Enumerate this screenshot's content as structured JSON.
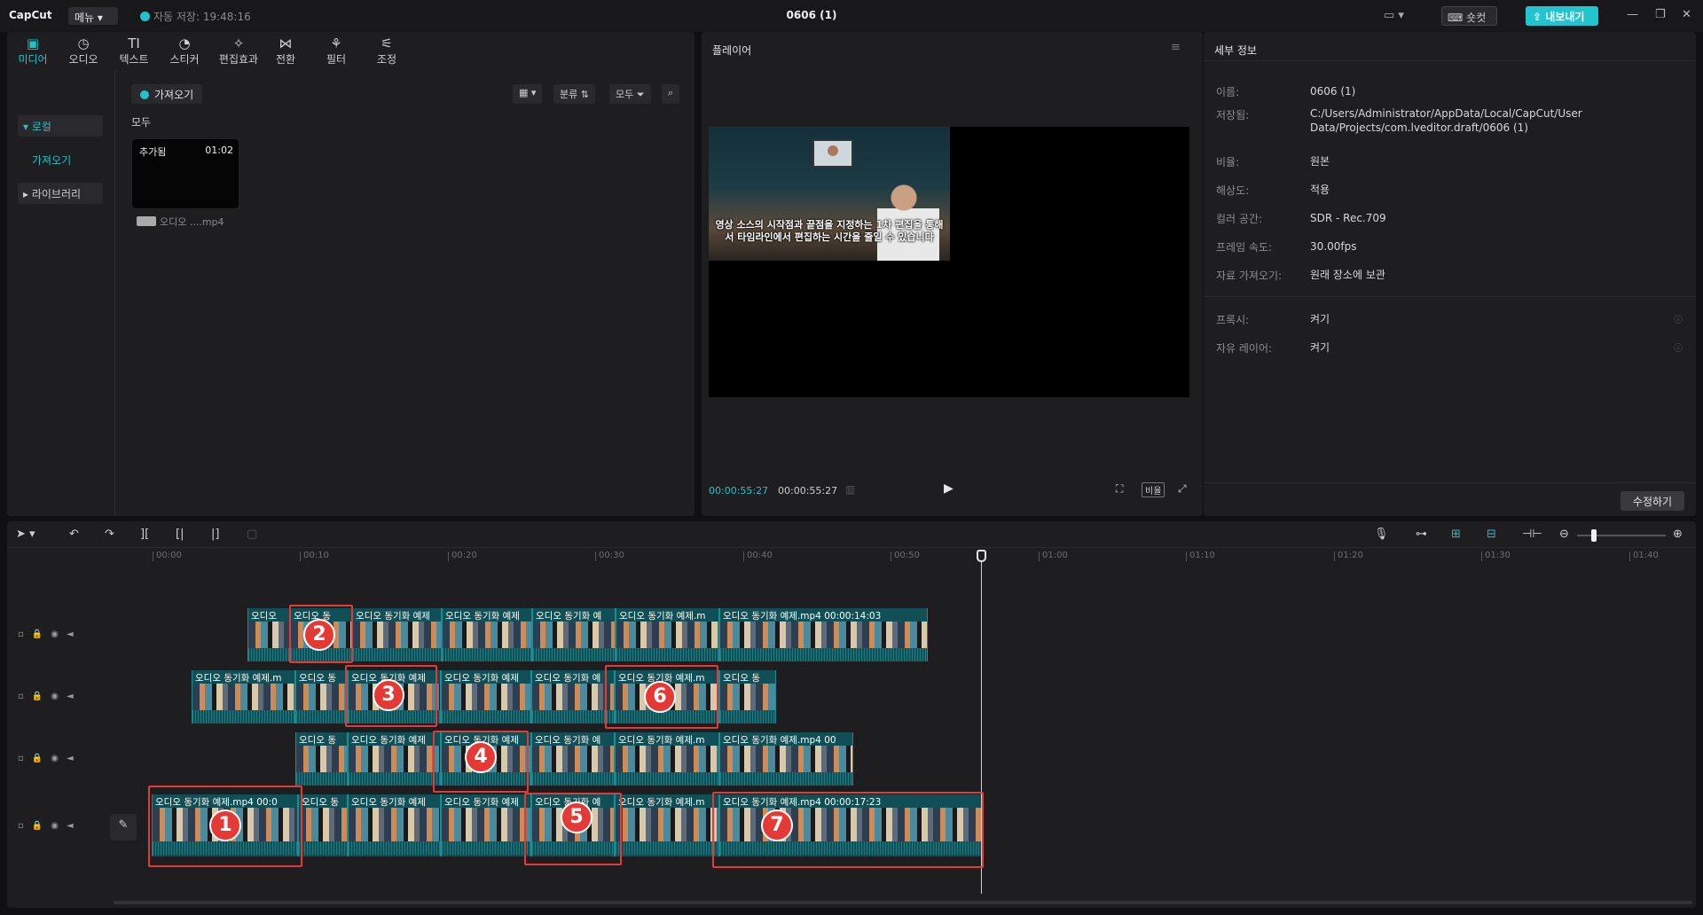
{
  "titlebar": {
    "logo": "CapCut",
    "menu_label": "메뉴",
    "autosave": "자동 저장: 19:48:16",
    "project_title": "0606 (1)",
    "shortcut_label": "숏컷",
    "export_label": "내보내기"
  },
  "media_tabs": [
    {
      "label": "미디어",
      "icon": "media-icon"
    },
    {
      "label": "오디오",
      "icon": "audio-icon"
    },
    {
      "label": "텍스트",
      "icon": "text-icon"
    },
    {
      "label": "스티커",
      "icon": "sticker-icon"
    },
    {
      "label": "편집효과",
      "icon": "effects-icon"
    },
    {
      "label": "전환",
      "icon": "transition-icon"
    },
    {
      "label": "필터",
      "icon": "filter-icon"
    },
    {
      "label": "조정",
      "icon": "adjust-icon"
    }
  ],
  "sidebar": {
    "local": "로컬",
    "import": "가져오기",
    "library": "라이브러리"
  },
  "media": {
    "import_button": "가져오기",
    "sort_label": "분류",
    "filter_label": "모두",
    "section_label": "모두",
    "clip": {
      "badge": "추가됨",
      "duration": "01:02",
      "name": "오디오 ....mp4"
    }
  },
  "player": {
    "title": "플레이어",
    "subtitle": "영상 소스의 시작점과 끝점을 지정하는 1차 편집을 통해서 타임라인에서 편집하는 시간을 줄일 수 있습니다",
    "current_time": "00:00:55:27",
    "total_time": "00:00:55:27",
    "ratio_label": "비율"
  },
  "details": {
    "title": "세부 정보",
    "rows": [
      {
        "label": "이름:",
        "value": "0606 (1)"
      },
      {
        "label": "저장됨:",
        "value": "C:/Users/Administrator/AppData/Local/CapCut/User Data/Projects/com.lveditor.draft/0606 (1)"
      },
      {
        "label": "비율:",
        "value": "원본"
      },
      {
        "label": "해상도:",
        "value": "적용"
      },
      {
        "label": "컬러 공간:",
        "value": "SDR - Rec.709"
      },
      {
        "label": "프레임 속도:",
        "value": "30.00fps"
      },
      {
        "label": "자료 가져오기:",
        "value": "원래 장소에 보관"
      },
      {
        "label": "프록시:",
        "value": "켜기"
      },
      {
        "label": "자유 레이어:",
        "value": "켜기"
      }
    ],
    "edit_button": "수정하기"
  },
  "timeline": {
    "ticks": [
      "00:00",
      "00:10",
      "00:20",
      "00:30",
      "00:40",
      "00:50",
      "01:00",
      "01:10",
      "01:20",
      "01:30",
      "01:40"
    ],
    "clip_labels": {
      "full": "오디오 동기화 예제.mp4",
      "cut_m": "오디오 동기화 예제.m",
      "cut_ye": "오디오 동기화 예제",
      "cut_ye_short": "오디오 동기화 예",
      "cut_short": "오디오 동",
      "cut_tiny": "오디오 동기",
      "cut_min": "오디오 동",
      "cut_two": "오디오 ",
      "full_dur_1": "오디오 동기화 예제.mp4  00:00:14:03",
      "full_dur_2": "오디오 동기화 예제.mp4  00:00:17:23",
      "full_dur_3": "오디오 동기화 예제.mp4  00",
      "full_dur_4": "오디오 동기화 예제.mp4  00:0"
    },
    "markers": [
      "1",
      "2",
      "3",
      "4",
      "5",
      "6",
      "7"
    ]
  }
}
